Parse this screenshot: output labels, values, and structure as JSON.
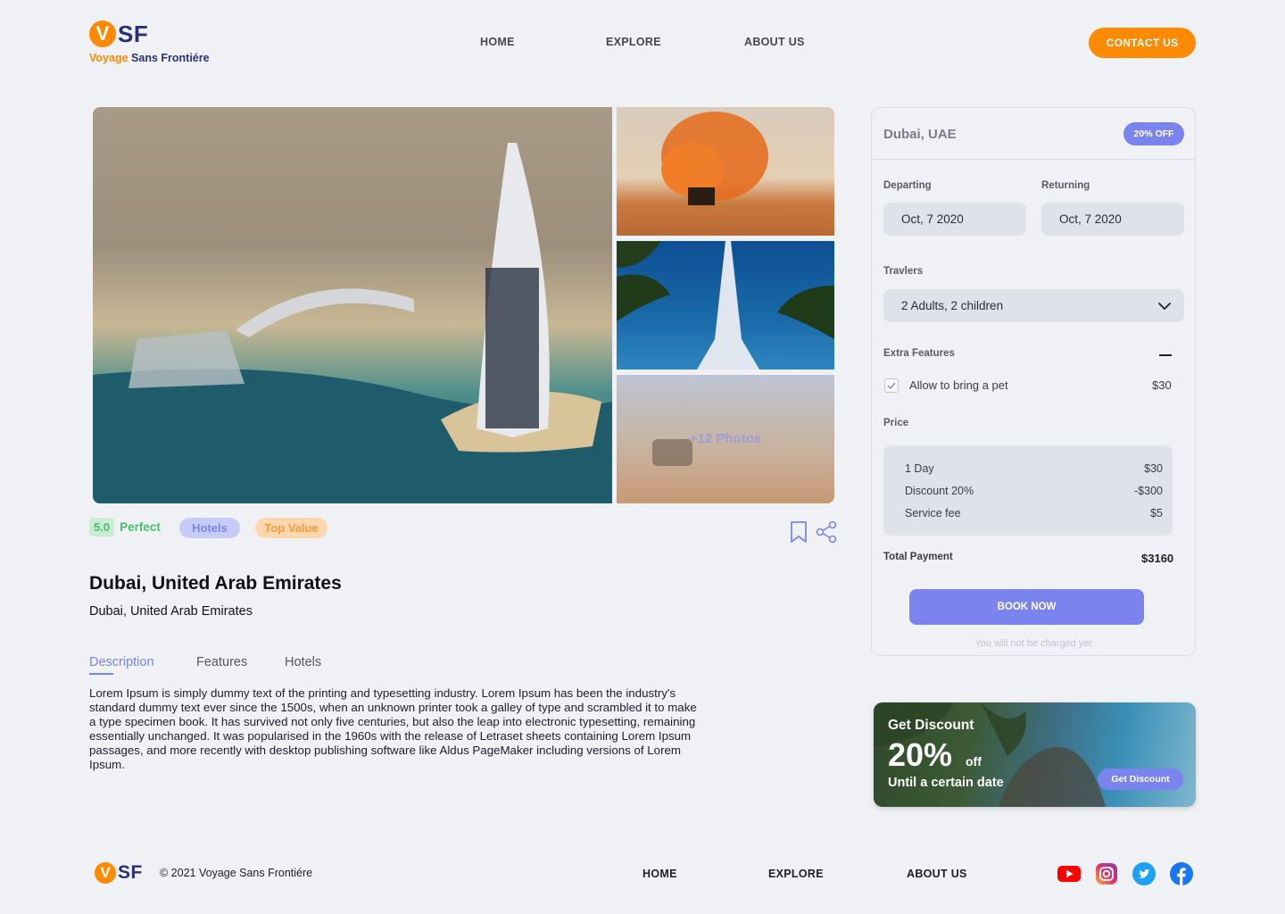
{
  "brand": {
    "mark_v": "V",
    "mark_sf": "SF",
    "name_part1": "Voyage",
    "name_part2": "Sans Frontiére"
  },
  "nav": {
    "home": "HOME",
    "explore": "EXPLORE",
    "about": "ABOUT US",
    "contact": "CONTACT US"
  },
  "gallery": {
    "more_photos": "+12 Photos"
  },
  "tags": {
    "rating": "5.0",
    "rating_label": "Perfect",
    "hotels": "Hotels",
    "top_value": "Top Value"
  },
  "destination": {
    "title": "Dubai, United Arab Emirates",
    "subtitle": "Dubai, United Arab Emirates"
  },
  "tabs": [
    {
      "label": "Description",
      "active": true
    },
    {
      "label": "Features",
      "active": false
    },
    {
      "label": "Hotels",
      "active": false
    }
  ],
  "description": "Lorem Ipsum is simply dummy text of the printing and typesetting industry. Lorem Ipsum has been the industry's standard dummy text ever since the 1500s, when an unknown printer took a galley of type and scrambled it to make a type specimen book. It has survived not only five centuries, but also the leap into electronic typesetting, remaining essentially unchanged. It was popularised in the 1960s with the release of Letraset sheets containing Lorem Ipsum passages, and more recently with desktop publishing software like Aldus PageMaker including versions of Lorem Ipsum.",
  "booking": {
    "location": "Dubai, UAE",
    "badge": "20% OFF",
    "departing_label": "Departing",
    "departing_value": "Oct, 7 2020",
    "returning_label": "Returning",
    "returning_value": "Oct, 7 2020",
    "travelers_label": "Travlers",
    "travelers_value": "2 Adults, 2 children",
    "extra_label": "Extra Features",
    "extra_item": "Allow to bring a pet",
    "extra_price": "$30",
    "extra_checked": true,
    "price_label": "Price",
    "price_rows": [
      {
        "label": "1 Day",
        "value": "$30"
      },
      {
        "label": "Discount 20%",
        "value": "-$300"
      },
      {
        "label": "Service fee",
        "value": "$5"
      }
    ],
    "total_label": "Total Payment",
    "total_value": "$3160",
    "book_button": "BOOK NOW",
    "note": "You will not be charged yet"
  },
  "promo": {
    "line1": "Get Discount",
    "big": "20%",
    "off": "off",
    "line2": "Until a certain date",
    "button": "Get Discount"
  },
  "footer": {
    "mark_v": "V",
    "mark_sf": "SF",
    "copyright": "© 2021 Voyage Sans Frontiére",
    "home": "HOME",
    "explore": "EXPLORE",
    "about": "ABOUT US",
    "social_icons": [
      "youtube-icon",
      "instagram-icon",
      "twitter-icon",
      "facebook-icon"
    ]
  },
  "colors": {
    "accent_orange": "#ff8a00",
    "accent_purple": "#7b83ee",
    "brand_navy": "#2a2f7a",
    "background": "#f0f1f5"
  }
}
